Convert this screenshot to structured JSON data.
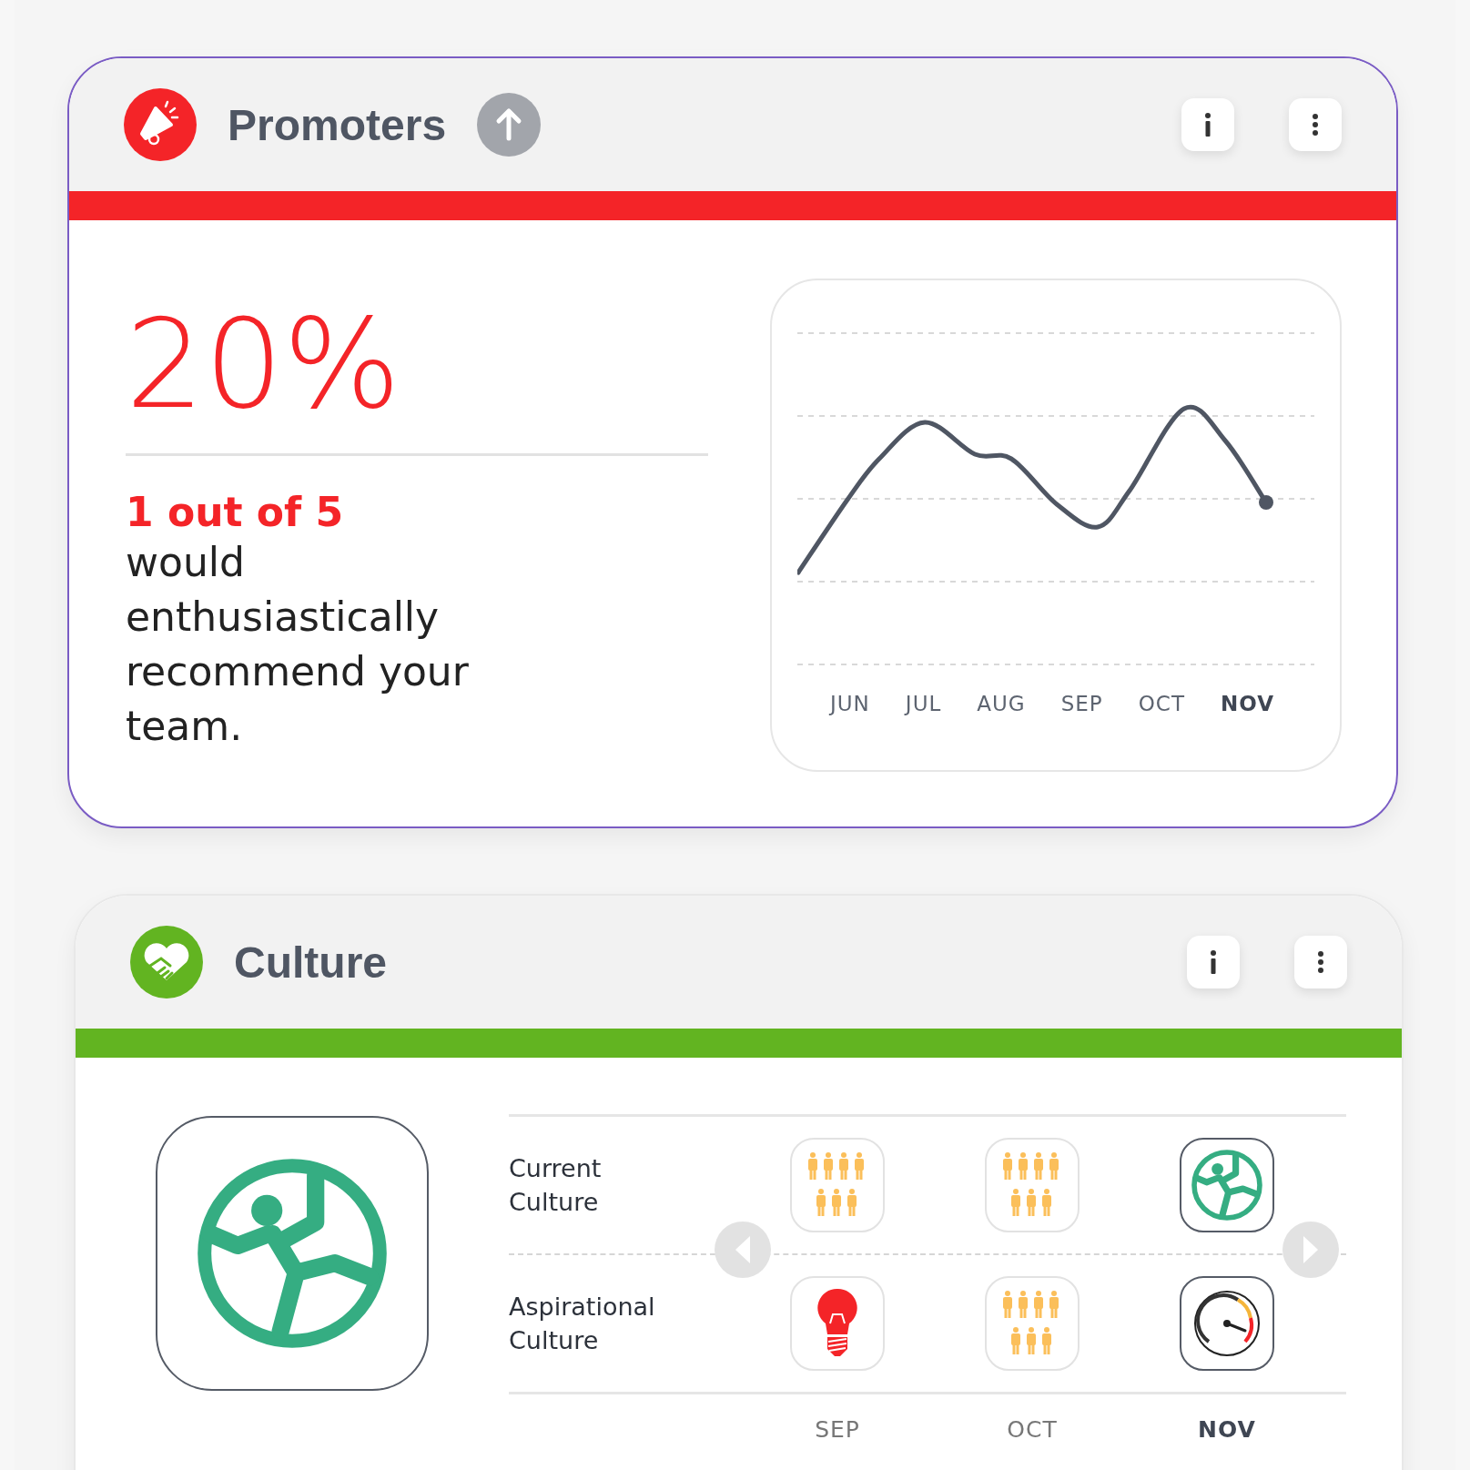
{
  "promoters": {
    "title": "Promoters",
    "trend_up": true,
    "percent": "20%",
    "highlight": "1 out of 5",
    "description": "would enthusiastically recommend your team.",
    "months": [
      {
        "label": "JUN",
        "selected": false
      },
      {
        "label": "JUL",
        "selected": false
      },
      {
        "label": "AUG",
        "selected": false
      },
      {
        "label": "SEP",
        "selected": false
      },
      {
        "label": "OCT",
        "selected": false
      },
      {
        "label": "NOV",
        "selected": true
      }
    ]
  },
  "culture": {
    "title": "Culture",
    "featured": {
      "kind": "climber"
    },
    "rows": [
      {
        "label": "Current Culture",
        "cells": [
          {
            "kind": "people"
          },
          {
            "kind": "people"
          },
          {
            "kind": "climber"
          }
        ]
      },
      {
        "label": "Aspirational Culture",
        "cells": [
          {
            "kind": "bulb"
          },
          {
            "kind": "people"
          },
          {
            "kind": "gauge"
          }
        ]
      }
    ],
    "columns": [
      {
        "label": "SEP",
        "selected": false
      },
      {
        "label": "OCT",
        "selected": false
      },
      {
        "label": "NOV",
        "selected": true
      }
    ]
  }
}
